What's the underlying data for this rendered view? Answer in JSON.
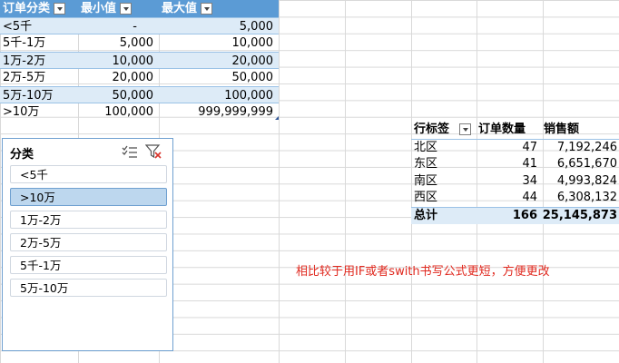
{
  "lookup_table": {
    "headers": [
      "订单分类",
      "最小值",
      "最大值"
    ],
    "rows": [
      [
        "<5千",
        "-",
        "5,000"
      ],
      [
        "5千-1万",
        "5,000",
        "10,000"
      ],
      [
        "1万-2万",
        "10,000",
        "20,000"
      ],
      [
        "2万-5万",
        "20,000",
        "50,000"
      ],
      [
        "5万-10万",
        "50,000",
        "100,000"
      ],
      [
        ">10万",
        "100,000",
        "999,999,999"
      ]
    ]
  },
  "slicer": {
    "title": "分类",
    "items": [
      "<5千",
      ">10万",
      "1万-2万",
      "2万-5万",
      "5千-1万",
      "5万-10万"
    ],
    "selected_index": 1
  },
  "pivot": {
    "headers": [
      "行标签",
      "订单数量",
      "销售额"
    ],
    "rows": [
      [
        "北区",
        "47",
        "7,192,246"
      ],
      [
        "东区",
        "41",
        "6,651,670"
      ],
      [
        "南区",
        "34",
        "4,993,824"
      ],
      [
        "西区",
        "44",
        "6,308,132"
      ]
    ],
    "total": [
      "总计",
      "166",
      "25,145,873"
    ]
  },
  "note": "相比较于用IF或者swith书写公式更短，方便更改",
  "colors": {
    "header_blue": "#5b9bd5",
    "band_blue": "#ddebf7",
    "slicer_selected": "#bdd7ee",
    "note_red": "#e0281e"
  }
}
